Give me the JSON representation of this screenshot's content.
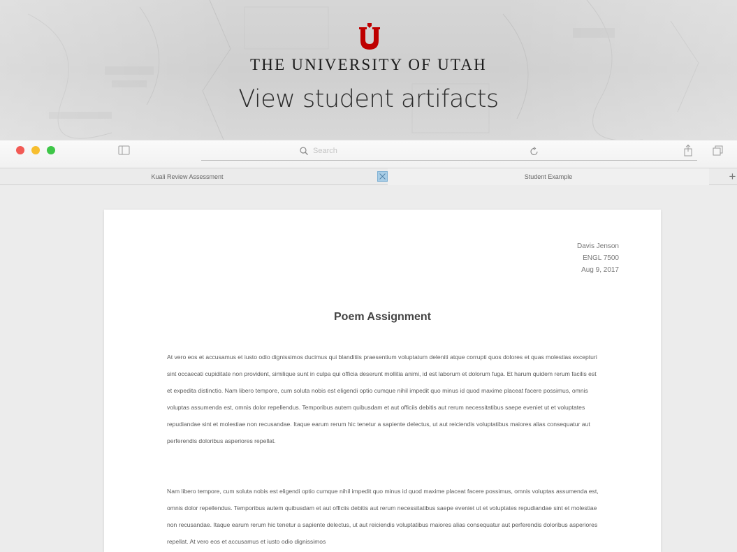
{
  "hero": {
    "institution": "THE UNIVERSITY OF UTAH",
    "title": "View student artifacts",
    "brand_color": "#be0000"
  },
  "browser": {
    "search_placeholder": "Search",
    "icons": {
      "sidebar": "sidebar-icon",
      "search": "magnifier-icon",
      "reload": "reload-icon",
      "share": "share-icon",
      "tabs": "tabs-overview-icon"
    },
    "traffic_colors": [
      "#f25a55",
      "#f7be2f",
      "#3ec648"
    ]
  },
  "tabs": [
    {
      "label": "Kuali Review Assessment"
    },
    {
      "label": "Student Example"
    }
  ],
  "tab_add_label": "+",
  "document": {
    "author": "Davis Jenson",
    "course": "ENGL 7500",
    "date": "Aug 9, 2017",
    "title": "Poem Assignment",
    "paragraphs": [
      "At vero eos et accusamus et iusto odio dignissimos ducimus qui blanditiis praesentium voluptatum deleniti atque corrupti quos dolores et quas molestias excepturi sint occaecati cupiditate non provident, similique sunt in culpa qui officia deserunt mollitia animi, id est laborum et dolorum fuga. Et harum quidem rerum facilis est et expedita distinctio. Nam libero tempore, cum soluta nobis est eligendi optio cumque nihil impedit quo minus id quod maxime placeat facere possimus, omnis voluptas assumenda est, omnis dolor repellendus. Temporibus autem quibusdam et aut officiis debitis aut rerum necessitatibus saepe eveniet ut et voluptates repudiandae sint et molestiae non recusandae. Itaque earum rerum hic tenetur a sapiente delectus, ut aut reiciendis voluptatibus maiores alias consequatur aut perferendis doloribus asperiores repellat.",
      "Nam libero tempore, cum soluta nobis est eligendi optio cumque nihil impedit quo minus id quod maxime placeat facere possimus, omnis voluptas assumenda est, omnis dolor repellendus. Temporibus autem quibusdam et aut officiis debitis aut rerum necessitatibus saepe eveniet ut et voluptates repudiandae sint et molestiae non recusandae. Itaque earum rerum hic tenetur a sapiente delectus, ut aut reiciendis voluptatibus maiores alias consequatur aut perferendis doloribus asperiores repellat. At vero eos et accusamus et iusto odio dignissimos"
    ]
  }
}
